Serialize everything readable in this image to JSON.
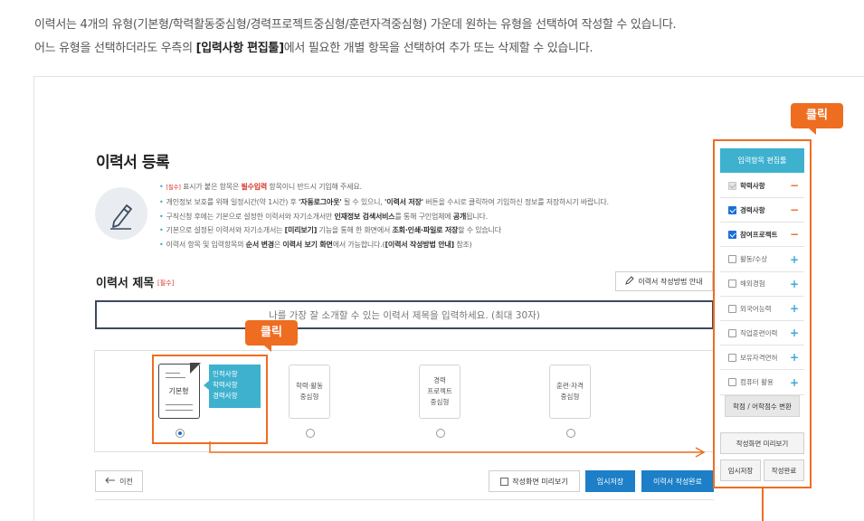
{
  "intro": {
    "line1": "이력서는 4개의 유형(기본형/학력활동중심형/경력프로젝트중심형/훈련자격중심형) 가운데 원하는 유형을 선택하여 작성할 수 있습니다.",
    "line2_before": "어느 유형을 선택하더라도 우측의 ",
    "line2_bold": "[입력사항 편집툴]",
    "line2_after": "에서 필요한 개별 항목을 선택하여 추가 또는 삭제할 수 있습니다."
  },
  "page": {
    "title": "이력서 등록",
    "notes": [
      {
        "parts": [
          {
            "t": "[필수]",
            "s": "red-small"
          },
          {
            "t": " 표시가 붙은 항목은 "
          },
          {
            "t": "필수입력",
            "s": "red-bold"
          },
          {
            "t": " 항목이니 반드시 기입해 주세요."
          }
        ]
      },
      {
        "parts": [
          {
            "t": "개인정보 보호를 위해 일정시간(약 1시간) 후 "
          },
          {
            "t": "'자동로그아웃'",
            "s": "bold"
          },
          {
            "t": " 될 수 있으니, "
          },
          {
            "t": "'이력서 저장'",
            "s": "bold"
          },
          {
            "t": " 버튼을 수시로 클릭하여 기입하신 정보를 저장하시기 바랍니다."
          }
        ]
      },
      {
        "parts": [
          {
            "t": "구직신청 후에는 기본으로 설정한 이력서와 자기소개서만 "
          },
          {
            "t": "인재정보 검색서비스",
            "s": "bold"
          },
          {
            "t": "를 통해 구인업체에 "
          },
          {
            "t": "공개",
            "s": "bold"
          },
          {
            "t": "됩니다."
          }
        ]
      },
      {
        "parts": [
          {
            "t": "기본으로 설정된 이력서와 자기소개서는 "
          },
          {
            "t": "[미리보기]",
            "s": "bold"
          },
          {
            "t": " 기능을 통해 한 화면에서 "
          },
          {
            "t": "조회·인쇄·파일로 저장",
            "s": "bold"
          },
          {
            "t": "할 수 있습니다"
          }
        ]
      },
      {
        "parts": [
          {
            "t": "이력서 항목 및 입력항목의 "
          },
          {
            "t": "순서 변경",
            "s": "bold"
          },
          {
            "t": "은 "
          },
          {
            "t": "이력서 보기 화면",
            "s": "bold"
          },
          {
            "t": "에서 가능합니다.("
          },
          {
            "t": "[이력서 작성방법 안내]",
            "s": "bold"
          },
          {
            "t": " 참조)"
          }
        ]
      }
    ]
  },
  "resume_title": {
    "label": "이력서 제목",
    "required": "[필수]",
    "guide_button": "이력서 작성방법 안내",
    "placeholder": "나를 가장 잘 소개할 수 있는 이력서 제목을 입력하세요. (최대 30자)"
  },
  "types": {
    "basic": {
      "label": "기본형",
      "selected": true
    },
    "tooltip": [
      "인적사항",
      "학력사항",
      "경력사항"
    ],
    "activity": [
      "학력·활동",
      "중심형"
    ],
    "career": [
      "경력",
      "프로젝트",
      "중심형"
    ],
    "training": [
      "훈련·자격",
      "중심형"
    ]
  },
  "callouts": {
    "click1": "클릭",
    "click2": "클릭"
  },
  "buttons": {
    "prev": "이전",
    "preview": "작성화면 미리보기",
    "temp_save": "임시저장",
    "complete": "이력서 작성완료"
  },
  "editor_panel": {
    "header": "입력항목 편집툴",
    "items": [
      {
        "label": "학력사항",
        "state": "disabled",
        "action": "−"
      },
      {
        "label": "경력사항",
        "state": "checked",
        "action": "−"
      },
      {
        "label": "참여프로젝트",
        "state": "checked",
        "action": "−"
      },
      {
        "label": "활동/수상",
        "state": "unchecked",
        "action": "+"
      },
      {
        "label": "해외경험",
        "state": "unchecked",
        "action": "+"
      },
      {
        "label": "외국어능력",
        "state": "unchecked",
        "action": "+"
      },
      {
        "label": "직업훈련이력",
        "state": "unchecked",
        "action": "+"
      },
      {
        "label": "보유자격면허",
        "state": "unchecked",
        "action": "+"
      },
      {
        "label": "컴퓨터 활용",
        "state": "unchecked",
        "action": "+"
      }
    ],
    "convert": "학점 / 어학점수 변환",
    "preview": "작성화면 미리보기",
    "temp_save": "임시저장",
    "complete": "작성완료"
  },
  "colors": {
    "accent": "#3eb1cf",
    "orange": "#ef6d20",
    "primary_button": "#1d7fc7",
    "required": "#d9362b"
  }
}
